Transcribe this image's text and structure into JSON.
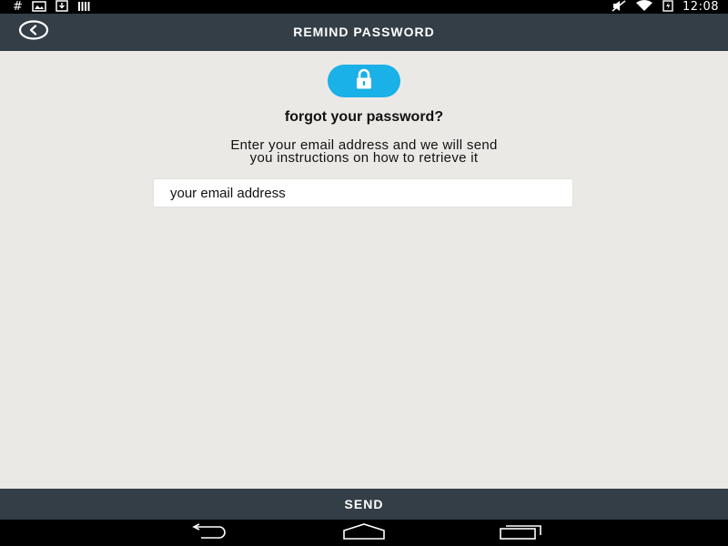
{
  "status_bar": {
    "time": "12:08",
    "left_icons": [
      "hash-icon",
      "image-icon",
      "download-icon",
      "bars-icon"
    ],
    "right_icons": [
      "mute-icon",
      "wifi-icon",
      "battery-charging-icon"
    ]
  },
  "action_bar": {
    "title": "REMIND PASSWORD",
    "back_icon": "back-circle-icon"
  },
  "main": {
    "lock_icon": "lock-icon",
    "accent_color": "#1ab0e8",
    "heading": "forgot your password?",
    "instructions_line1": "Enter your email address and we will send",
    "instructions_line2": "you instructions on how to retrieve it",
    "email_placeholder": "your email address",
    "email_value": ""
  },
  "footer": {
    "send_label": "SEND"
  },
  "nav_bar": {
    "buttons": [
      "back-nav-icon",
      "home-nav-icon",
      "recents-nav-icon"
    ]
  }
}
